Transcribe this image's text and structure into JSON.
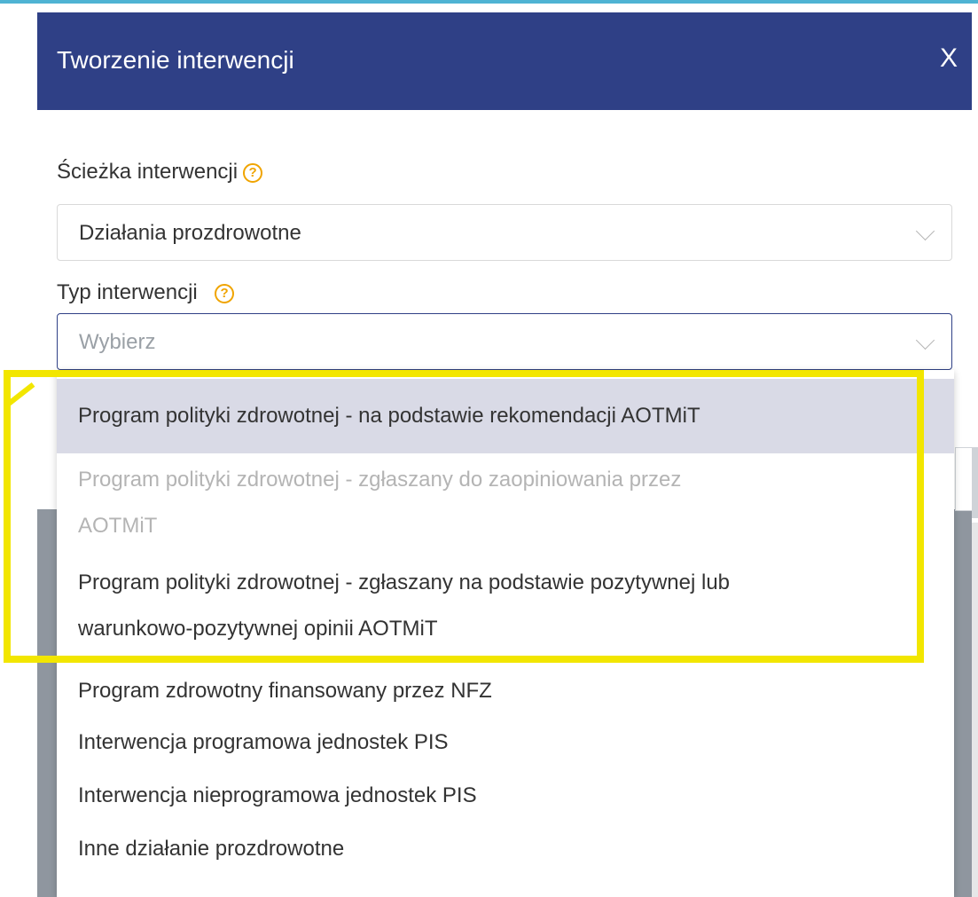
{
  "modal": {
    "title": "Tworzenie interwencji",
    "close_symbol": "X"
  },
  "form": {
    "path_label": "Ścieżka interwencji",
    "path_value": "Działania prozdrowotne",
    "type_label": "Typ interwencji",
    "type_placeholder": "Wybierz",
    "help_symbol": "?"
  },
  "dropdown": {
    "options": [
      {
        "lines": [
          "Program polityki zdrowotnej - na podstawie rekomendacji AOTMiT"
        ],
        "state": "active"
      },
      {
        "lines": [
          "Program polityki zdrowotnej - zgłaszany do zaopiniowania przez",
          "AOTMiT"
        ],
        "state": "disabled"
      },
      {
        "lines": [
          "Program polityki zdrowotnej - zgłaszany na podstawie pozytywnej lub",
          "warunkowo-pozytywnej opinii AOTMiT"
        ],
        "state": "normal"
      },
      {
        "lines": [
          "Program zdrowotny finansowany przez NFZ"
        ],
        "state": "normal"
      },
      {
        "lines": [
          "Interwencja programowa jednostek PIS"
        ],
        "state": "normal"
      },
      {
        "lines": [
          "Interwencja nieprogramowa jednostek PIS"
        ],
        "state": "normal"
      },
      {
        "lines": [
          "Inne działanie prozdrowotne"
        ],
        "state": "normal"
      }
    ]
  },
  "colors": {
    "header": "#2f4086",
    "highlight": "#f2e600",
    "accent_line": "#4fb3d3"
  },
  "icons": {
    "close": "close-icon",
    "help": "question-circle-icon",
    "chevron": "chevron-down-icon"
  }
}
